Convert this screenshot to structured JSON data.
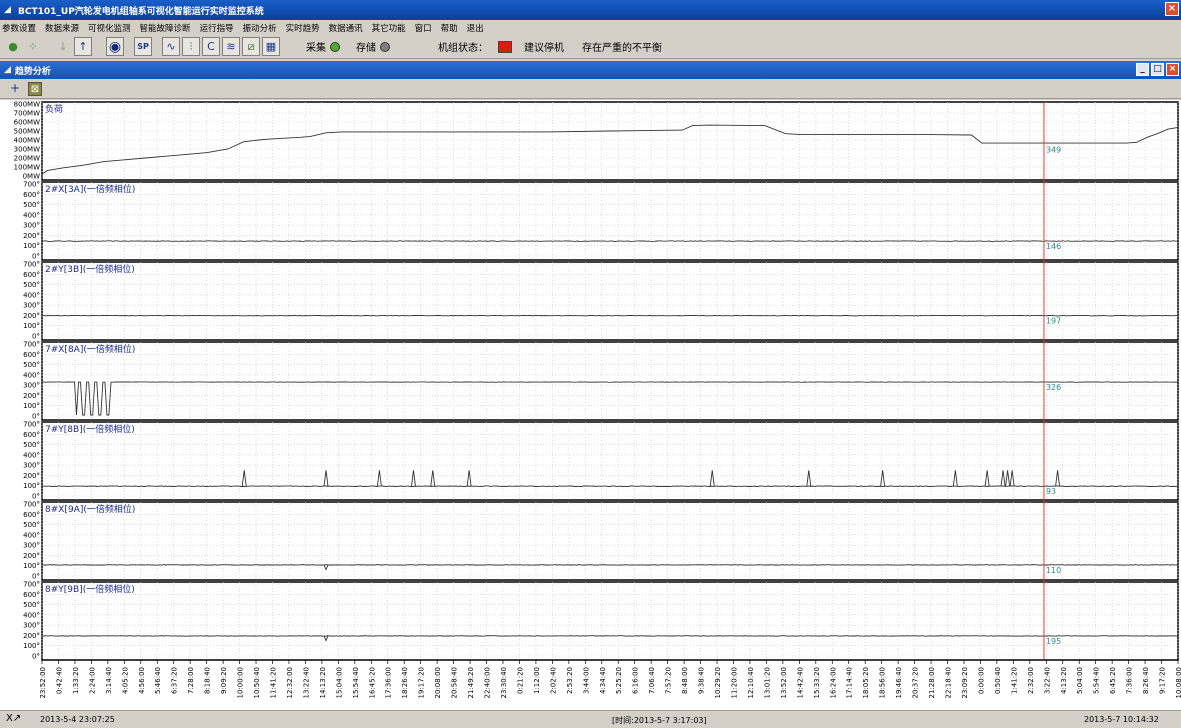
{
  "window": {
    "title": "BCT101_UP汽轮发电机组轴系可视化智能运行实时监控系统"
  },
  "menu": [
    "参数设置",
    "数据来源",
    "可视化监测",
    "智能故障诊断",
    "运行指导",
    "振动分析",
    "实时趋势",
    "数据通讯",
    "其它功能",
    "窗口",
    "帮助",
    "退出"
  ],
  "toolbar": {
    "collect_label": "采集",
    "store_label": "存储",
    "unit_state_label": "机组状态：",
    "unit_state_value": "建议停机",
    "alarm_text": "存在严重的不平衡",
    "collect_led_color": "#4cae2c",
    "store_led_color": "#808080",
    "state_led_color": "#d81e06"
  },
  "child_window": {
    "title": "趋势分析"
  },
  "status": {
    "left_icon": "X↗",
    "start_time": "2013-5-4 23:07:25",
    "cursor_time": "[时间:2013-5-7 3:17:03]",
    "end_time": "2013-5-7 10:14:32"
  },
  "chart_data": {
    "type": "line",
    "cursor_time": "3:17:03",
    "x_ticks": [
      "23:52:00",
      "0:42:40",
      "1:33:20",
      "2:24:00",
      "3:14:40",
      "4:05:20",
      "4:56:00",
      "5:46:40",
      "6:37:20",
      "7:28:00",
      "8:18:40",
      "9:09:20",
      "10:00:00",
      "10:50:40",
      "11:41:20",
      "12:32:00",
      "13:22:40",
      "14:13:20",
      "15:04:00",
      "15:54:40",
      "16:45:20",
      "17:36:00",
      "18:26:40",
      "19:17:20",
      "20:08:00",
      "20:58:40",
      "21:49:20",
      "22:40:00",
      "23:30:40",
      "0:21:20",
      "1:12:00",
      "2:02:40",
      "2:53:20",
      "3:44:00",
      "4:34:40",
      "5:25:20",
      "6:16:00",
      "7:06:40",
      "7:57:20",
      "8:48:00",
      "9:38:40",
      "10:29:20",
      "11:20:00",
      "12:10:40",
      "13:01:20",
      "13:52:00",
      "14:42:40",
      "15:33:20",
      "16:24:00",
      "17:14:40",
      "18:05:20",
      "18:56:00",
      "19:46:40",
      "20:37:20",
      "21:28:00",
      "22:18:40",
      "23:09:20",
      "0:00:00",
      "0:50:40",
      "1:41:20",
      "2:32:00",
      "3:22:40",
      "4:13:20",
      "5:04:00",
      "5:54:40",
      "6:45:20",
      "7:36:00",
      "8:26:40",
      "9:17:20",
      "10:08:00"
    ],
    "panels": [
      {
        "name": "负荷",
        "yticks": [
          "800MW",
          "700MW",
          "600MW",
          "500MW",
          "400MW",
          "300MW",
          "200MW",
          "100MW",
          "0MW"
        ],
        "ylim": [
          0,
          800
        ],
        "cursor_value": "349",
        "color": "#000000",
        "points": [
          [
            0,
            20
          ],
          [
            0.5,
            60
          ],
          [
            2,
            90
          ],
          [
            4,
            120
          ],
          [
            6,
            160
          ],
          [
            8,
            180
          ],
          [
            10,
            200
          ],
          [
            12,
            220
          ],
          [
            14,
            240
          ],
          [
            16,
            260
          ],
          [
            18,
            300
          ],
          [
            19.5,
            380
          ],
          [
            21,
            400
          ],
          [
            22,
            410
          ],
          [
            23.5,
            420
          ],
          [
            25,
            430
          ],
          [
            26,
            440
          ],
          [
            27.5,
            480
          ],
          [
            29,
            490
          ],
          [
            35,
            490
          ],
          [
            43,
            490
          ],
          [
            49,
            490
          ],
          [
            55,
            500
          ],
          [
            62,
            510
          ],
          [
            63,
            560
          ],
          [
            64.5,
            565
          ],
          [
            70,
            560
          ],
          [
            72,
            470
          ],
          [
            73.5,
            460
          ],
          [
            78,
            460
          ],
          [
            86,
            460
          ],
          [
            90,
            455
          ],
          [
            91,
            365
          ],
          [
            96,
            365
          ],
          [
            100,
            365
          ],
          [
            105,
            365
          ],
          [
            106,
            375
          ],
          [
            107,
            430
          ],
          [
            108,
            470
          ],
          [
            109,
            520
          ],
          [
            110,
            540
          ]
        ],
        "xmax": 110
      },
      {
        "name": "2#X[3A](一倍频相位)",
        "yticks": [
          "700°",
          "600°",
          "500°",
          "400°",
          "300°",
          "200°",
          "100°",
          "0°"
        ],
        "ylim": [
          0,
          700
        ],
        "cursor_value": "146",
        "color": "#000000",
        "base": 145,
        "noise": 6
      },
      {
        "name": "2#Y[3B](一倍频相位)",
        "yticks": [
          "700°",
          "600°",
          "500°",
          "400°",
          "300°",
          "200°",
          "100°",
          "0°"
        ],
        "ylim": [
          0,
          700
        ],
        "cursor_value": "197",
        "color": "#000000",
        "base": 198,
        "noise": 5
      },
      {
        "name": "7#X[8A](一倍频相位)",
        "yticks": [
          "700°",
          "600°",
          "500°",
          "400°",
          "300°",
          "200°",
          "100°",
          "0°"
        ],
        "ylim": [
          0,
          700
        ],
        "cursor_value": "326",
        "color": "#000000",
        "base": 330,
        "noise": 4
      },
      {
        "name": "7#Y[8B](一倍频相位)",
        "yticks": [
          "700°",
          "600°",
          "500°",
          "400°",
          "300°",
          "200°",
          "100°",
          "0°"
        ],
        "ylim": [
          0,
          700
        ],
        "cursor_value": "93",
        "color": "#000000",
        "base": 95,
        "noise": 6
      },
      {
        "name": "8#X[9A](一倍频相位)",
        "yticks": [
          "700°",
          "600°",
          "500°",
          "400°",
          "300°",
          "200°",
          "100°",
          "0°"
        ],
        "ylim": [
          0,
          700
        ],
        "cursor_value": "110",
        "color": "#000000",
        "base": 108,
        "noise": 5
      },
      {
        "name": "8#Y[9B](一倍频相位)",
        "yticks": [
          "700°",
          "600°",
          "500°",
          "400°",
          "300°",
          "200°",
          "100°",
          "0°"
        ],
        "ylim": [
          0,
          700
        ],
        "cursor_value": "195",
        "color": "#000000",
        "base": 195,
        "noise": 5
      }
    ],
    "cursor_color": "#e0403a",
    "grid": true
  }
}
